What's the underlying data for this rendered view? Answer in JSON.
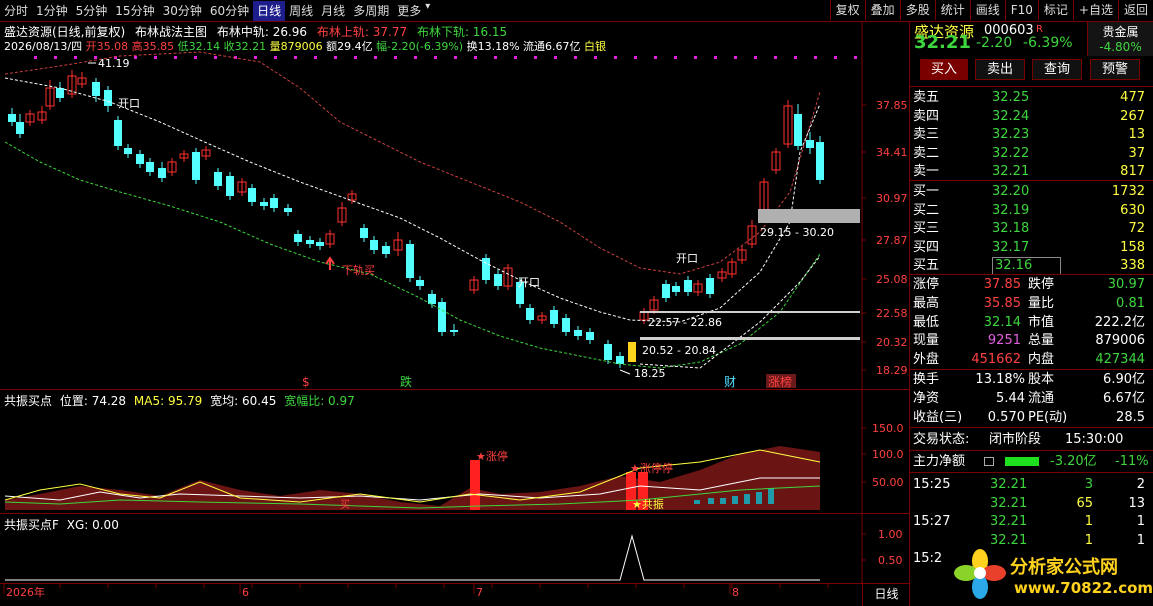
{
  "toolbar": {
    "periods": [
      "分时",
      "1分钟",
      "5分钟",
      "15分钟",
      "30分钟",
      "60分钟",
      "日线",
      "周线",
      "月线",
      "多周期",
      "更多"
    ],
    "active_period": 6,
    "right_buttons": [
      "复权",
      "叠加",
      "多股",
      "统计",
      "画线",
      "F10",
      "标记",
      "+自选",
      "返回"
    ]
  },
  "main": {
    "stock_title": "盛达资源(日线,前复权)",
    "indicator_name": "布林战法主图",
    "mid_label": "布林中轨: 26.96",
    "up_label": "布林上轨: 37.77",
    "low_label": "布林下轨: 16.15",
    "info_date": "2026/08/13/四",
    "info_open": "开35.08",
    "info_high": "高35.85",
    "info_low": "低32.14",
    "info_close": "收32.21",
    "info_vol": "量879006",
    "info_amount": "额29.4亿",
    "info_change": "幅-2.20(-6.39%)",
    "info_turn": "换13.18%",
    "info_float": "流通6.67亿",
    "info_sector": "白银",
    "price_axis": [
      "37.85",
      "34.41",
      "30.97",
      "27.87",
      "25.08",
      "22.58",
      "20.32",
      "18.29"
    ],
    "annotations": {
      "max_price": "41.19",
      "min_price": "18.25",
      "open1": "开口",
      "open2": "开口",
      "open3": "开口",
      "lower_buy": "下轨买",
      "range1": "29.15 - 30.20",
      "range2": "22.57 - 22.86",
      "range3": "20.52 - 20.84"
    },
    "event_markers": [
      {
        "text": "$",
        "color": "#ff4040"
      },
      {
        "text": "跌",
        "color": "#3ed63e"
      },
      {
        "text": "财",
        "color": "#4fe0ff"
      },
      {
        "text": "涨榜",
        "color": "#ff4040"
      }
    ]
  },
  "sub1": {
    "name": "共振买点",
    "pos_label": "位置: 74.28",
    "ma5_label": "MA5: 95.79",
    "width_label": "宽均: 60.45",
    "ratio_label": "宽幅比: 0.97",
    "axis": [
      "150.0",
      "100.0",
      "50.00"
    ],
    "labels": {
      "limit_up1": "★涨停",
      "limit_up2": "★涨停停",
      "resonance": "★共振",
      "buy": "买"
    }
  },
  "sub2": {
    "name": "共振买点F",
    "xg_label": "XG: 0.00",
    "axis": [
      "1.00",
      "0.50"
    ]
  },
  "time_axis": [
    "2026年",
    "6",
    "7",
    "8"
  ],
  "bottom_status": "日线",
  "quote": {
    "name": "盛达资源",
    "code": "000603",
    "tag": "R",
    "sector": "贵金属",
    "sector_change": "-4.80%",
    "price": "32.21",
    "change": "-2.20",
    "change_pct": "-6.39%",
    "buttons": [
      "买入",
      "卖出",
      "查询",
      "预警"
    ],
    "asks": [
      {
        "label": "卖五",
        "price": "32.25",
        "vol": "477"
      },
      {
        "label": "卖四",
        "price": "32.24",
        "vol": "267"
      },
      {
        "label": "卖三",
        "price": "32.23",
        "vol": "13"
      },
      {
        "label": "卖二",
        "price": "32.22",
        "vol": "37"
      },
      {
        "label": "卖一",
        "price": "32.21",
        "vol": "817"
      }
    ],
    "bids": [
      {
        "label": "买一",
        "price": "32.20",
        "vol": "1732"
      },
      {
        "label": "买二",
        "price": "32.19",
        "vol": "630"
      },
      {
        "label": "买三",
        "price": "32.18",
        "vol": "72"
      },
      {
        "label": "买四",
        "price": "32.17",
        "vol": "158"
      },
      {
        "label": "买五",
        "price": "32.16",
        "vol": "338"
      }
    ],
    "stats1": [
      {
        "l1": "涨停",
        "v1": "37.85",
        "c1": "red",
        "l2": "跌停",
        "v2": "30.97",
        "c2": "green"
      },
      {
        "l1": "最高",
        "v1": "35.85",
        "c1": "red",
        "l2": "量比",
        "v2": "0.81",
        "c2": "green"
      },
      {
        "l1": "最低",
        "v1": "32.14",
        "c1": "green",
        "l2": "市值",
        "v2": "222.2亿",
        "c2": "white"
      },
      {
        "l1": "现量",
        "v1": "9251",
        "c1": "mag",
        "l2": "总量",
        "v2": "879006",
        "c2": "white"
      },
      {
        "l1": "外盘",
        "v1": "451662",
        "c1": "red",
        "l2": "内盘",
        "v2": "427344",
        "c2": "green"
      }
    ],
    "stats2": [
      {
        "l1": "换手",
        "v1": "13.18%",
        "l2": "股本",
        "v2": "6.90亿"
      },
      {
        "l1": "净资",
        "v1": "5.44",
        "l2": "流通",
        "v2": "6.67亿"
      },
      {
        "l1": "收益(三)",
        "v1": "0.570",
        "l2": "PE(动)",
        "v2": "28.5"
      }
    ],
    "trade_status_label": "交易状态:",
    "trade_status": "闭市阶段",
    "trade_time": "15:30:00",
    "main_net_label": "主力净额",
    "main_net": "-3.20亿",
    "main_net_pct": "-11%",
    "ticks": [
      {
        "time": "15:25",
        "price": "32.21",
        "vol": "3",
        "n": "2",
        "vc": "green"
      },
      {
        "time": "",
        "price": "32.21",
        "vol": "65",
        "n": "13",
        "vc": "yellow"
      },
      {
        "time": "15:27",
        "price": "32.21",
        "vol": "1",
        "n": "1",
        "vc": "yellow"
      },
      {
        "time": "",
        "price": "32.21",
        "vol": "1",
        "n": "1",
        "vc": "yellow"
      },
      {
        "time": "15:2",
        "price": "",
        "vol": "",
        "n": "",
        "vc": "yellow"
      }
    ],
    "watermark_title": "分析家公式网",
    "watermark_url": "www.70822.com"
  }
}
